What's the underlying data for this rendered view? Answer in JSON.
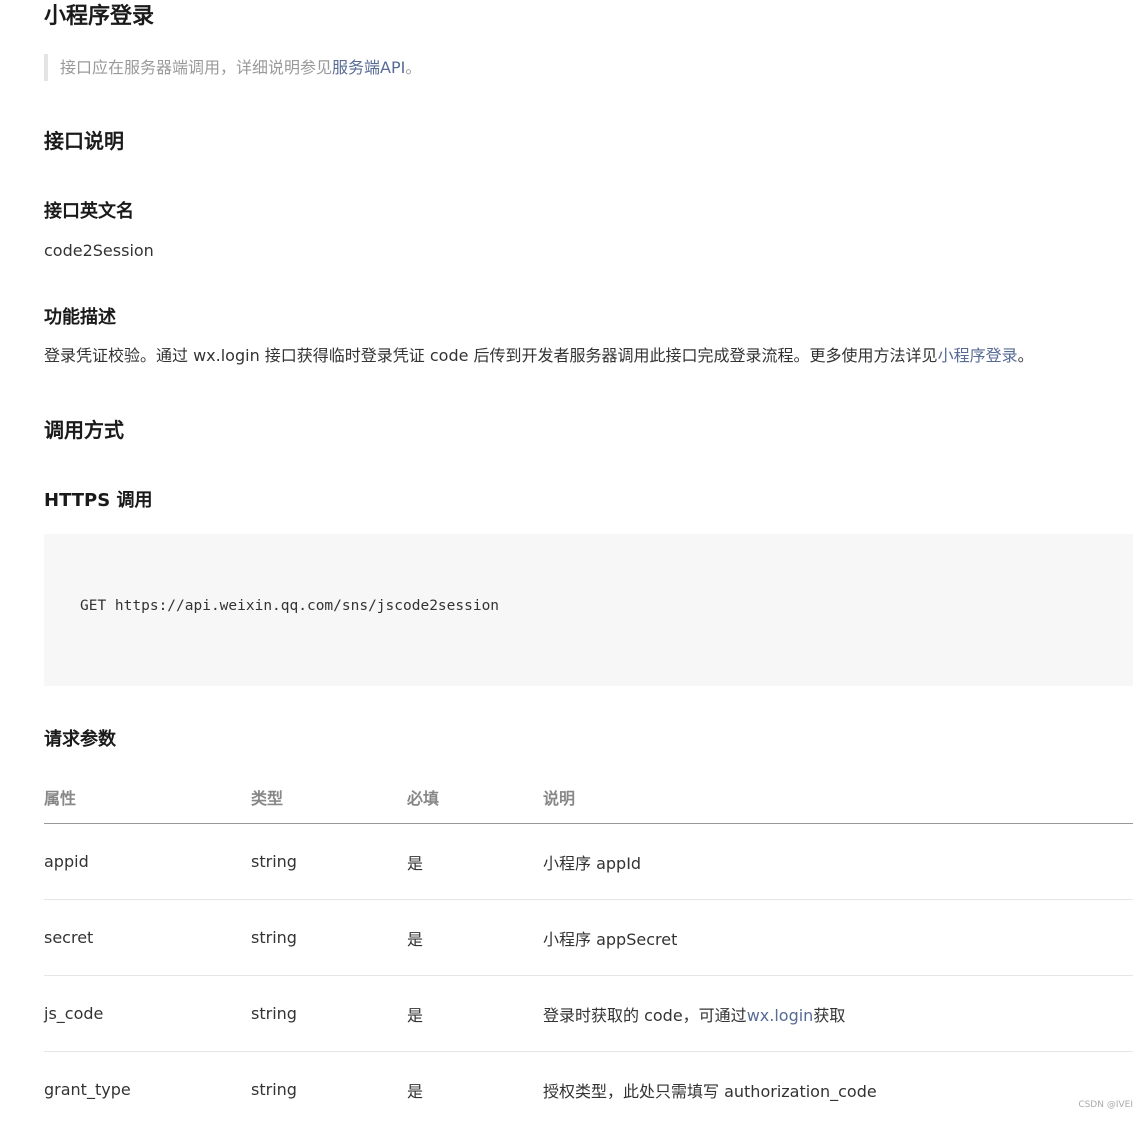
{
  "title": "小程序登录",
  "notice": {
    "prefix": "接口应在服务器端调用，详细说明参见",
    "link": "服务端API",
    "suffix": "。"
  },
  "interface_section": {
    "heading": "接口说明",
    "english_name_heading": "接口英文名",
    "english_name": "code2Session",
    "function_heading": "功能描述",
    "function_prefix": "登录凭证校验。通过 wx.login 接口获得临时登录凭证 code 后传到开发者服务器调用此接口完成登录流程。更多使用方法详见",
    "function_link": "小程序登录",
    "function_suffix": "。"
  },
  "call_section": {
    "heading": "调用方式",
    "https_heading": "HTTPS 调用",
    "code": "GET https://api.weixin.qq.com/sns/jscode2session"
  },
  "params": {
    "heading": "请求参数",
    "columns": [
      "属性",
      "类型",
      "必填",
      "说明"
    ],
    "rows": [
      {
        "name": "appid",
        "type": "string",
        "required": "是",
        "desc": "小程序 appId",
        "desc_link": "",
        "desc_suffix": ""
      },
      {
        "name": "secret",
        "type": "string",
        "required": "是",
        "desc": "小程序 appSecret",
        "desc_link": "",
        "desc_suffix": ""
      },
      {
        "name": "js_code",
        "type": "string",
        "required": "是",
        "desc": "登录时获取的 code，可通过",
        "desc_link": "wx.login",
        "desc_suffix": "获取"
      },
      {
        "name": "grant_type",
        "type": "string",
        "required": "是",
        "desc": "授权类型，此处只需填写 authorization_code",
        "desc_link": "",
        "desc_suffix": ""
      }
    ]
  },
  "watermark": "CSDN @IVEI"
}
